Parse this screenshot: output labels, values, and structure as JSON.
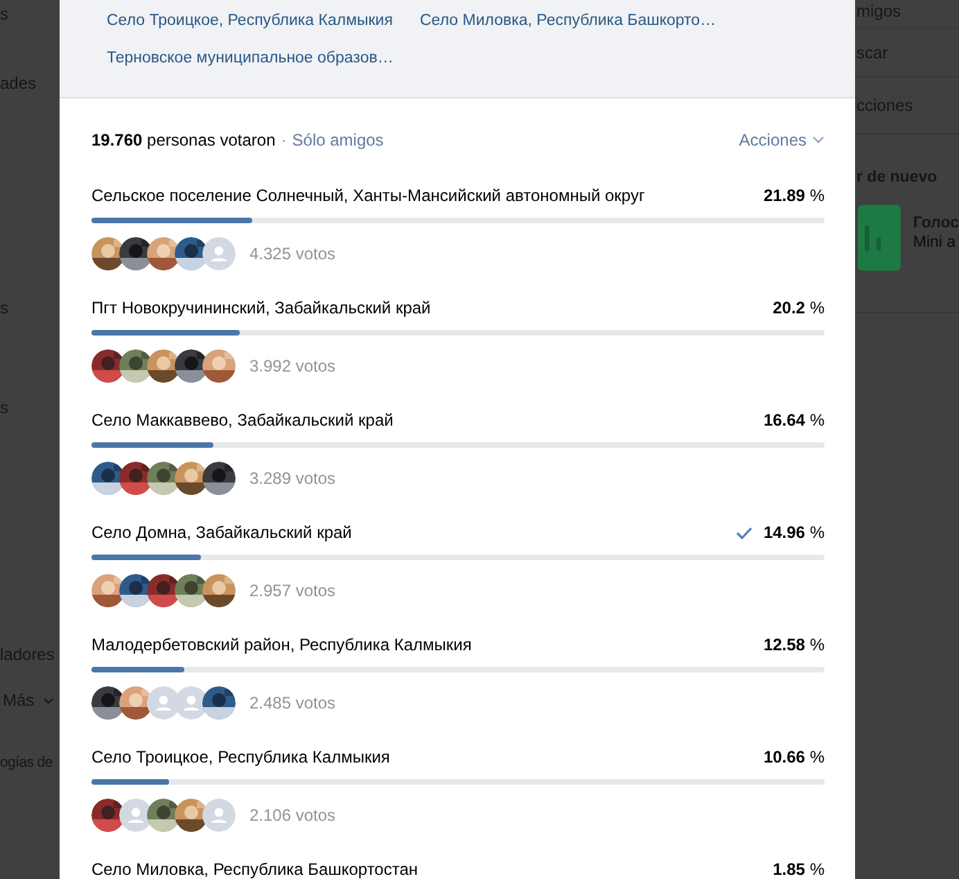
{
  "background_left": {
    "items": [
      {
        "label": "s"
      },
      {
        "label": "ades"
      },
      {
        "label": "s"
      },
      {
        "label": "s"
      },
      {
        "label": "ladores"
      },
      {
        "label": "Más",
        "caret": true
      },
      {
        "label": "ogías de"
      }
    ]
  },
  "background_right": {
    "items": [
      {
        "label": "migos"
      },
      {
        "label": "scar"
      },
      {
        "label": "cciones"
      }
    ],
    "heading": "r de nuevo",
    "card": {
      "title": "Голос",
      "subtitle": "Mini a"
    }
  },
  "options_links": [
    "Село Троицкое, Республика Калмыкия",
    "Село Миловка, Республика Башкорто…",
    "Терновское муниципальное образов…"
  ],
  "summary": {
    "voters": "**19.760** personas votaron",
    "separator": "·",
    "filter": "Sólo amigos",
    "actions": "Acciones"
  },
  "results": [
    {
      "label": "Сельское поселение Солнечный, Ханты-Мансийский автономный округ",
      "percent": "**21.89** %",
      "voted": false,
      "level": 0.2189,
      "votes": "4.325 votos",
      "avatars": [
        {
          "kind": "picture"
        },
        {
          "kind": "picture"
        },
        {
          "kind": "picture"
        },
        {
          "kind": "picture"
        },
        {
          "kind": "placeholder"
        }
      ]
    },
    {
      "label": "Пгт Новокручининский, Забайкальский край",
      "percent": "**20.2** %",
      "voted": false,
      "level": 0.202,
      "votes": "3.992 votos",
      "avatars": [
        {
          "kind": "picture"
        },
        {
          "kind": "picture"
        },
        {
          "kind": "picture"
        },
        {
          "kind": "picture"
        },
        {
          "kind": "picture"
        }
      ]
    },
    {
      "label": "Село Маккаввево, Забайкальский край",
      "percent": "**16.64** %",
      "voted": false,
      "level": 0.1664,
      "votes": "3.289 votos",
      "avatars": [
        {
          "kind": "picture"
        },
        {
          "kind": "picture"
        },
        {
          "kind": "picture"
        },
        {
          "kind": "picture"
        },
        {
          "kind": "picture"
        }
      ]
    },
    {
      "label": "Село Домна, Забайкальский край",
      "percent": "**14.96** %",
      "voted": true,
      "level": 0.1496,
      "votes": "2.957 votos",
      "avatars": [
        {
          "kind": "picture"
        },
        {
          "kind": "picture"
        },
        {
          "kind": "picture"
        },
        {
          "kind": "picture"
        },
        {
          "kind": "picture"
        }
      ]
    },
    {
      "label": "Малодербетовский район, Республика Калмыкия",
      "percent": "**12.58** %",
      "voted": false,
      "level": 0.1258,
      "votes": "2.485 votos",
      "avatars": [
        {
          "kind": "picture"
        },
        {
          "kind": "picture"
        },
        {
          "kind": "placeholder"
        },
        {
          "kind": "placeholder"
        },
        {
          "kind": "picture"
        }
      ]
    },
    {
      "label": "Село Троицкое, Республика Калмыкия",
      "percent": "**10.66** %",
      "voted": false,
      "level": 0.1066,
      "votes": "2.106 votos",
      "avatars": [
        {
          "kind": "picture"
        },
        {
          "kind": "placeholder"
        },
        {
          "kind": "picture"
        },
        {
          "kind": "picture"
        },
        {
          "kind": "placeholder"
        }
      ]
    },
    {
      "label": "Село Миловка, Республика Башкортостан",
      "percent": "**1.85** %",
      "voted": false
    }
  ]
}
